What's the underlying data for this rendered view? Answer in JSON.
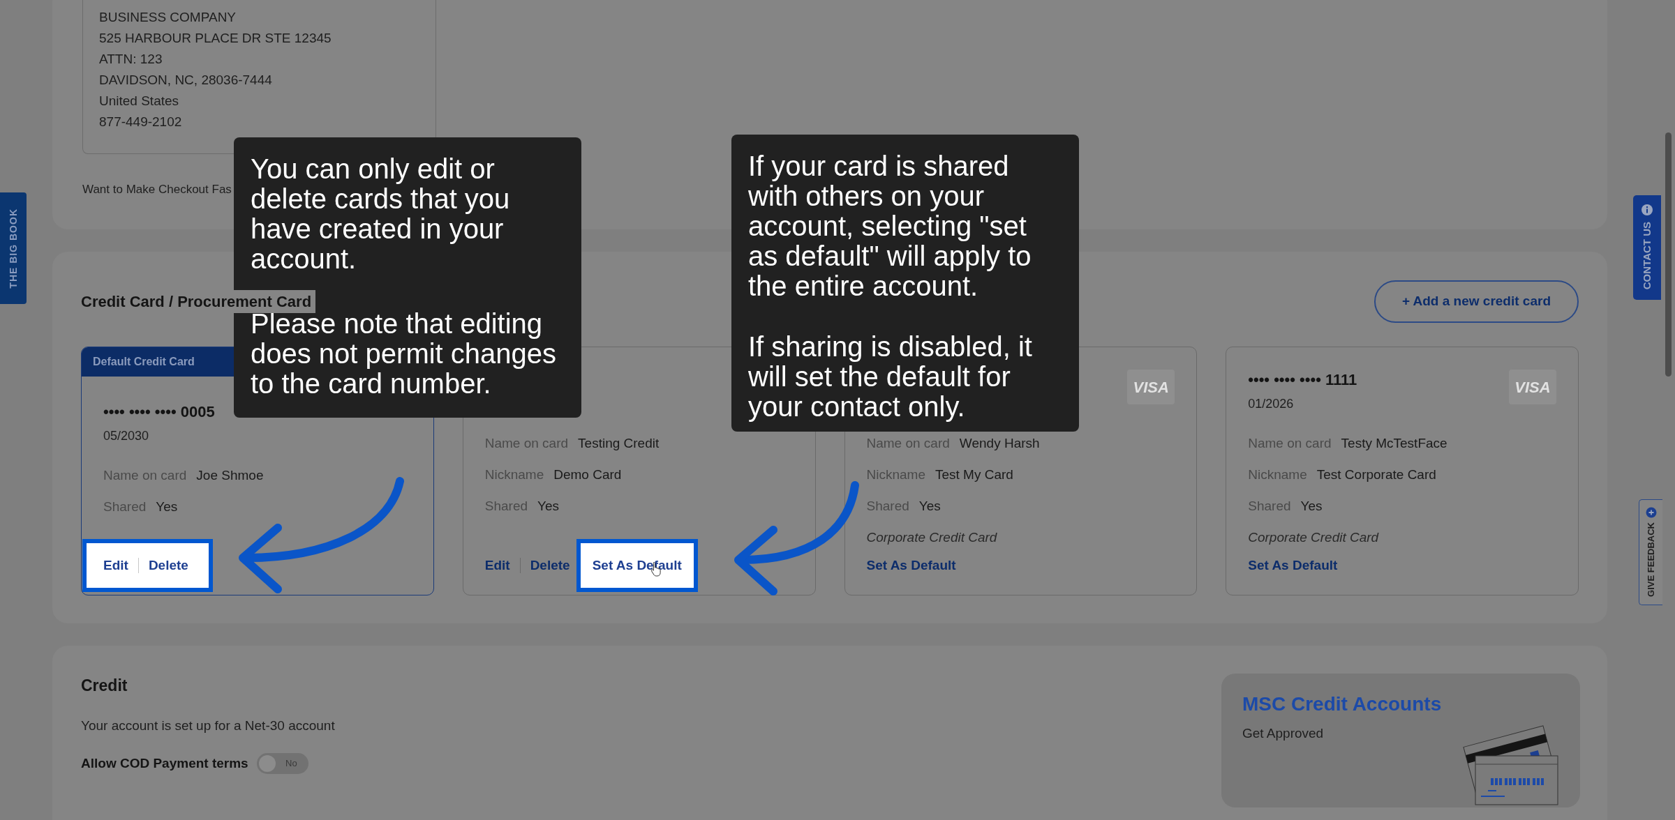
{
  "side_tabs": {
    "left": "THE BIG BOOK",
    "contact": "CONTACT US",
    "feedback": "GIVE FEEDBACK"
  },
  "address": {
    "lines": [
      "BUSINESS COMPANY",
      "525 HARBOUR PLACE DR STE 12345",
      "ATTN: 123",
      "DAVIDSON, NC, 28036-7444",
      "United States",
      "877-449-2102"
    ]
  },
  "checkout_prompt": "Want to Make Checkout Fas",
  "cards_section": {
    "title": "Credit Card / Procurement Card",
    "add_button": "+ Add a new credit card",
    "cards": [
      {
        "default": true,
        "header": "Default Credit Card",
        "number": "•••• •••• •••• 0005",
        "expiry": "05/2030",
        "fields": [
          {
            "label": "Name on card",
            "value": "Joe Shmoe"
          },
          {
            "label": "Shared",
            "value": "Yes"
          }
        ],
        "actions": [
          {
            "label": "Edit",
            "kind": "edit",
            "highlighted": true
          },
          {
            "label": "Delete",
            "kind": "delete",
            "highlighted": true
          }
        ]
      },
      {
        "default": false,
        "fields": [
          {
            "label": "Name on card",
            "value": "Testing Credit"
          },
          {
            "label": "Nickname",
            "value": "Demo Card"
          },
          {
            "label": "Shared",
            "value": "Yes"
          }
        ],
        "actions": [
          {
            "label": "Edit",
            "kind": "edit",
            "highlighted": false
          },
          {
            "label": "Delete",
            "kind": "delete",
            "highlighted": false
          },
          {
            "label": "Set As Default",
            "kind": "set_default",
            "highlighted": true
          }
        ]
      },
      {
        "default": false,
        "logo_text": "VISA",
        "fields": [
          {
            "label": "Name on card",
            "value": "Wendy Harsh"
          },
          {
            "label": "Nickname",
            "value": "Test My Card"
          },
          {
            "label": "Shared",
            "value": "Yes"
          }
        ],
        "note": "Corporate Credit Card",
        "actions": [
          {
            "label": "Set As Default",
            "kind": "set_default",
            "highlighted": false
          }
        ]
      },
      {
        "default": false,
        "number": "•••• •••• •••• 1111",
        "expiry": "01/2026",
        "logo_text": "VISA",
        "fields": [
          {
            "label": "Name on card",
            "value": "Testy McTestFace"
          },
          {
            "label": "Nickname",
            "value": "Test Corporate Card"
          },
          {
            "label": "Shared",
            "value": "Yes"
          }
        ],
        "note": "Corporate Credit Card",
        "actions": [
          {
            "label": "Set As Default",
            "kind": "set_default",
            "highlighted": false
          }
        ]
      }
    ]
  },
  "credit_section": {
    "title": "Credit",
    "description": "Your account is set up for a Net-30 account",
    "cod": {
      "label": "Allow COD Payment terms",
      "on": false,
      "state_text": "No"
    },
    "promo": {
      "title": "MSC Credit Accounts",
      "subtitle": "Get Approved"
    }
  },
  "tooltips": [
    {
      "paragraphs": [
        "You can only edit or delete cards that you have created in your account.",
        "Please note that editing does not permit changes to the card number."
      ]
    },
    {
      "paragraphs": [
        "If your card is shared with others on your account, selecting \"set as default\" will apply to the entire account.",
        "If sharing is disabled, it will set the default for your contact only."
      ]
    }
  ]
}
